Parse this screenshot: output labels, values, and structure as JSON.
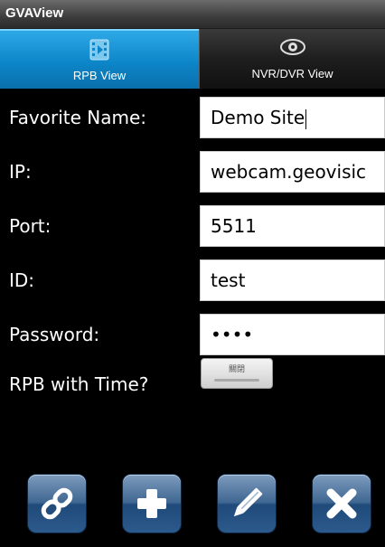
{
  "app": {
    "title": "GVAView"
  },
  "tabs": [
    {
      "label": "RPB View",
      "icon": "film-icon",
      "active": true
    },
    {
      "label": "NVR/DVR View",
      "icon": "eye-icon",
      "active": false
    }
  ],
  "form": {
    "favorite_name": {
      "label": "Favorite Name:",
      "value": "Demo Site"
    },
    "ip": {
      "label": "IP:",
      "value": "webcam.geovisic"
    },
    "port": {
      "label": "Port:",
      "value": "5511"
    },
    "id": {
      "label": "ID:",
      "value": "test"
    },
    "password": {
      "label": "Password:",
      "value": "••••"
    },
    "rpb_with_time": {
      "label": "RPB with Time?",
      "toggle_text": "關閉",
      "state": "off"
    }
  },
  "toolbar": [
    {
      "name": "connect-button",
      "icon": "link-icon"
    },
    {
      "name": "add-button",
      "icon": "plus-icon"
    },
    {
      "name": "edit-button",
      "icon": "pencil-icon"
    },
    {
      "name": "delete-button",
      "icon": "close-icon"
    }
  ],
  "colors": {
    "active_tab": "#0d86c9",
    "button": "#3f6792",
    "background": "#000000"
  }
}
